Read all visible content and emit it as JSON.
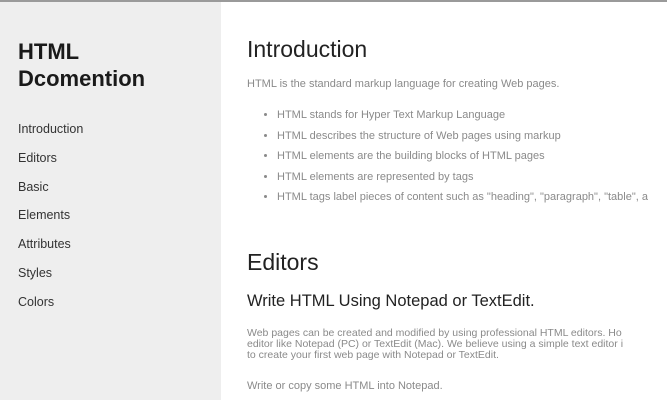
{
  "sidebar": {
    "title_line1": "HTML",
    "title_line2": "Dcomention",
    "items": [
      {
        "label": "Introduction"
      },
      {
        "label": "Editors"
      },
      {
        "label": "Basic"
      },
      {
        "label": "Elements"
      },
      {
        "label": "Attributes"
      },
      {
        "label": "Styles"
      },
      {
        "label": "Colors"
      }
    ]
  },
  "main": {
    "introduction": {
      "heading": "Introduction",
      "paragraph": "HTML is the standard markup language for creating Web pages.",
      "bullets": [
        "HTML stands for Hyper Text Markup Language",
        "HTML describes the structure of Web pages using markup",
        "HTML elements are the building blocks of HTML pages",
        "HTML elements are represented by tags",
        "HTML tags label pieces of content such as \"heading\", \"paragraph\", \"table\", a"
      ]
    },
    "editors": {
      "heading": "Editors",
      "subheading": "Write HTML Using Notepad or TextEdit.",
      "paragraph_lines": [
        "Web pages can be created and modified by using professional HTML editors. Ho",
        "editor like Notepad (PC) or TextEdit (Mac). We believe using a simple text editor i",
        "to create your first web page with Notepad or TextEdit."
      ],
      "paragraph2": "Write or copy some HTML into Notepad."
    }
  }
}
